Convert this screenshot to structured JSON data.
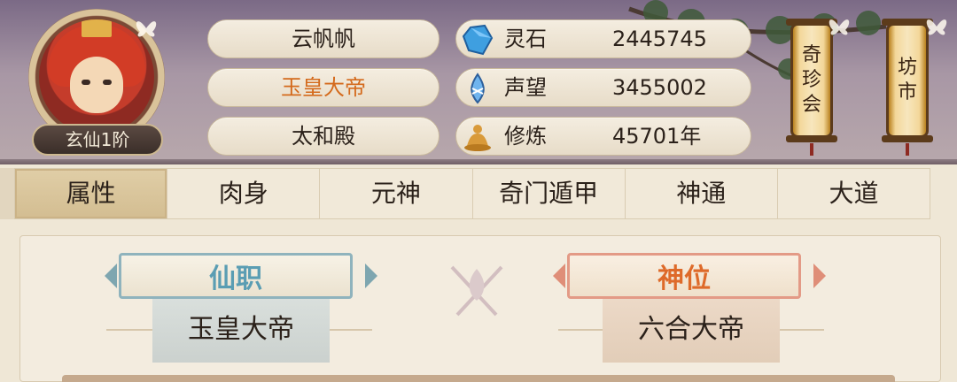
{
  "player": {
    "rank": "玄仙1阶",
    "name": "云帆帆",
    "title": "玉皇大帝",
    "hall": "太和殿"
  },
  "stats": [
    {
      "icon": "spirit-stone-icon",
      "label": "灵石",
      "value": "2445745"
    },
    {
      "icon": "reputation-icon",
      "label": "声望",
      "value": "3455002"
    },
    {
      "icon": "cultivation-icon",
      "label": "修炼",
      "value": "45701年"
    }
  ],
  "lanterns": {
    "treasure": [
      "奇",
      "珍",
      "会"
    ],
    "market": [
      "坊",
      "市"
    ]
  },
  "tabs": [
    "属性",
    "肉身",
    "元神",
    "奇门遁甲",
    "神通",
    "大道"
  ],
  "main": {
    "immortal_post_label": "仙职",
    "immortal_post_value": "玉皇大帝",
    "divine_rank_label": "神位",
    "divine_rank_value": "六合大帝"
  },
  "colors": {
    "accent_orange": "#d46a1c",
    "xianzhi_blue": "#5a9db3",
    "shenwei_orange": "#de6a2a",
    "active_tab": "#d3bd91"
  }
}
